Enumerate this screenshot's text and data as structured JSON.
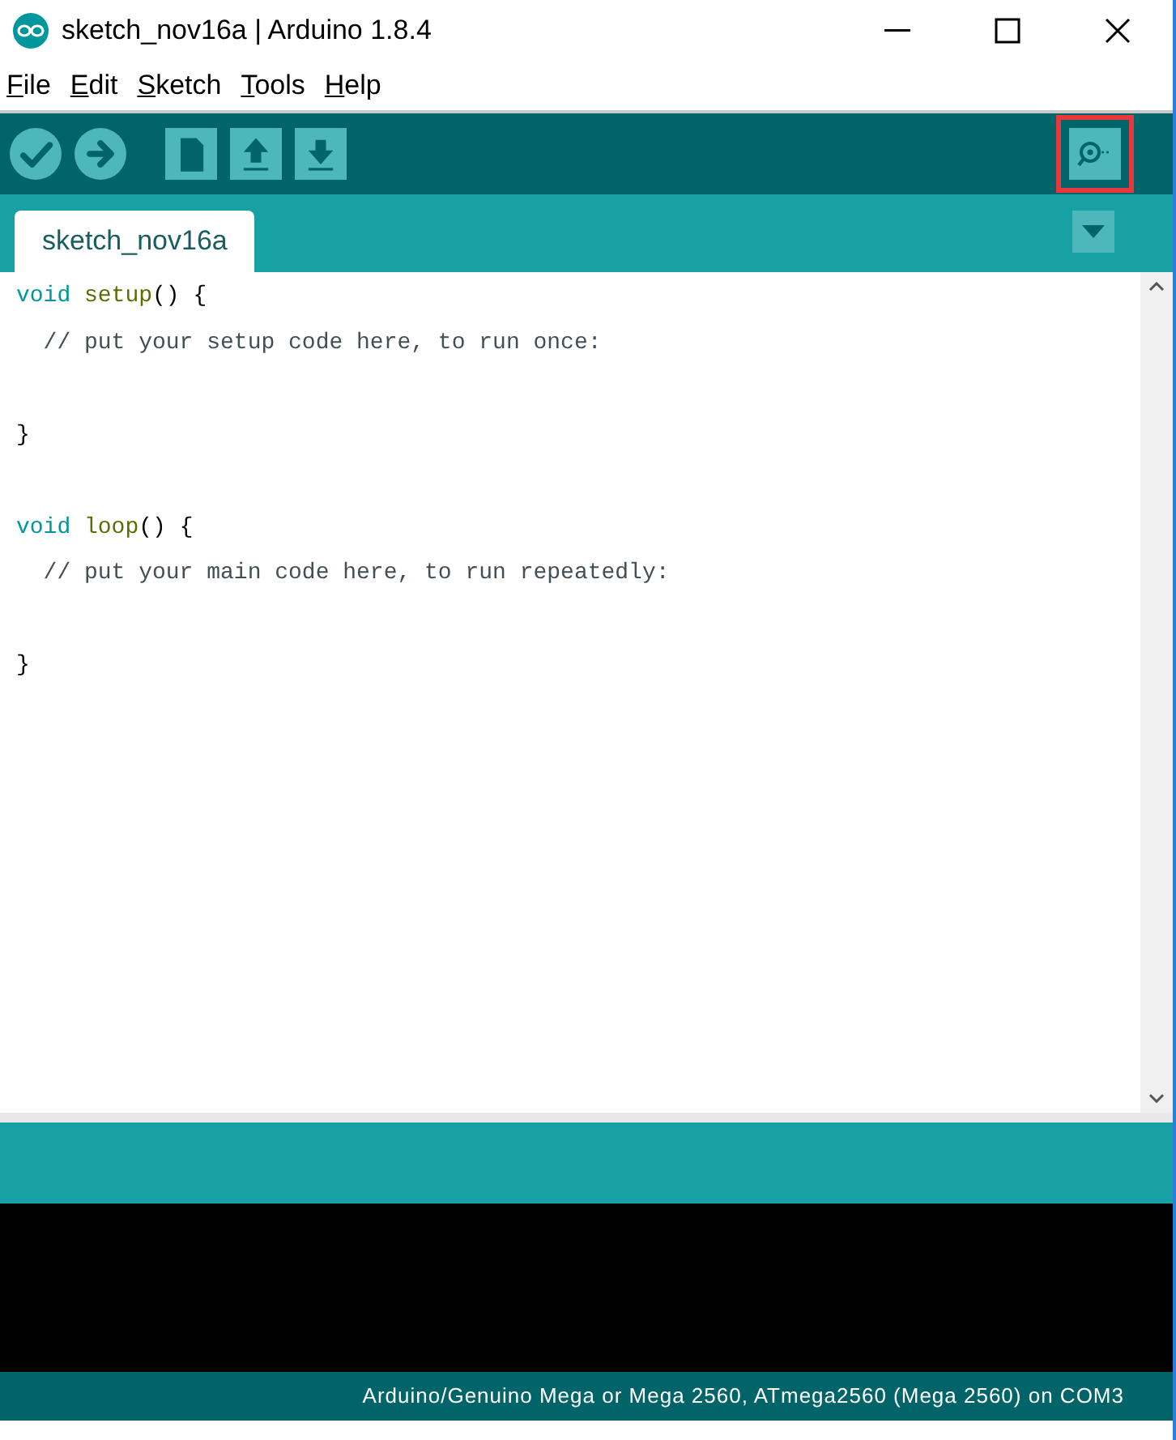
{
  "window": {
    "title": "sketch_nov16a | Arduino 1.8.4"
  },
  "menu": [
    "File",
    "Edit",
    "Sketch",
    "Tools",
    "Help"
  ],
  "toolbar": [
    {
      "kind": "verify"
    },
    {
      "kind": "upload"
    },
    {
      "kind": "new"
    },
    {
      "kind": "open"
    },
    {
      "kind": "save"
    }
  ],
  "serial_monitor": {
    "highlighted": true
  },
  "tabs": [
    {
      "label": "sketch_nov16a",
      "selected": true
    }
  ],
  "editor": {
    "lines": [
      {
        "kind": "code",
        "tokens": [
          {
            "text": "void",
            "kind": "keyword"
          },
          {
            "text": "setup",
            "kind": "function"
          },
          {
            "text": "() {",
            "kind": "plain"
          }
        ]
      },
      {
        "kind": "code",
        "tokens": [
          {
            "text": "// put your setup code here, to run once:",
            "kind": "comment"
          }
        ]
      },
      {
        "kind": "blank"
      },
      {
        "kind": "code",
        "tokens": [
          {
            "text": "}",
            "kind": "plain"
          }
        ]
      },
      {
        "kind": "blank"
      },
      {
        "kind": "code",
        "tokens": [
          {
            "text": "void",
            "kind": "keyword"
          },
          {
            "text": "loop",
            "kind": "function"
          },
          {
            "text": "() {",
            "kind": "plain"
          }
        ]
      },
      {
        "kind": "code",
        "tokens": [
          {
            "text": "// put your main code here, to run repeatedly:",
            "kind": "comment"
          }
        ]
      },
      {
        "kind": "blank"
      },
      {
        "kind": "code",
        "tokens": [
          {
            "text": "}",
            "kind": "plain"
          }
        ]
      }
    ]
  },
  "status_bar": {
    "board": "Arduino/Genuino Mega or Mega 2560, ATmega2560 (Mega 2560) on COM3"
  }
}
